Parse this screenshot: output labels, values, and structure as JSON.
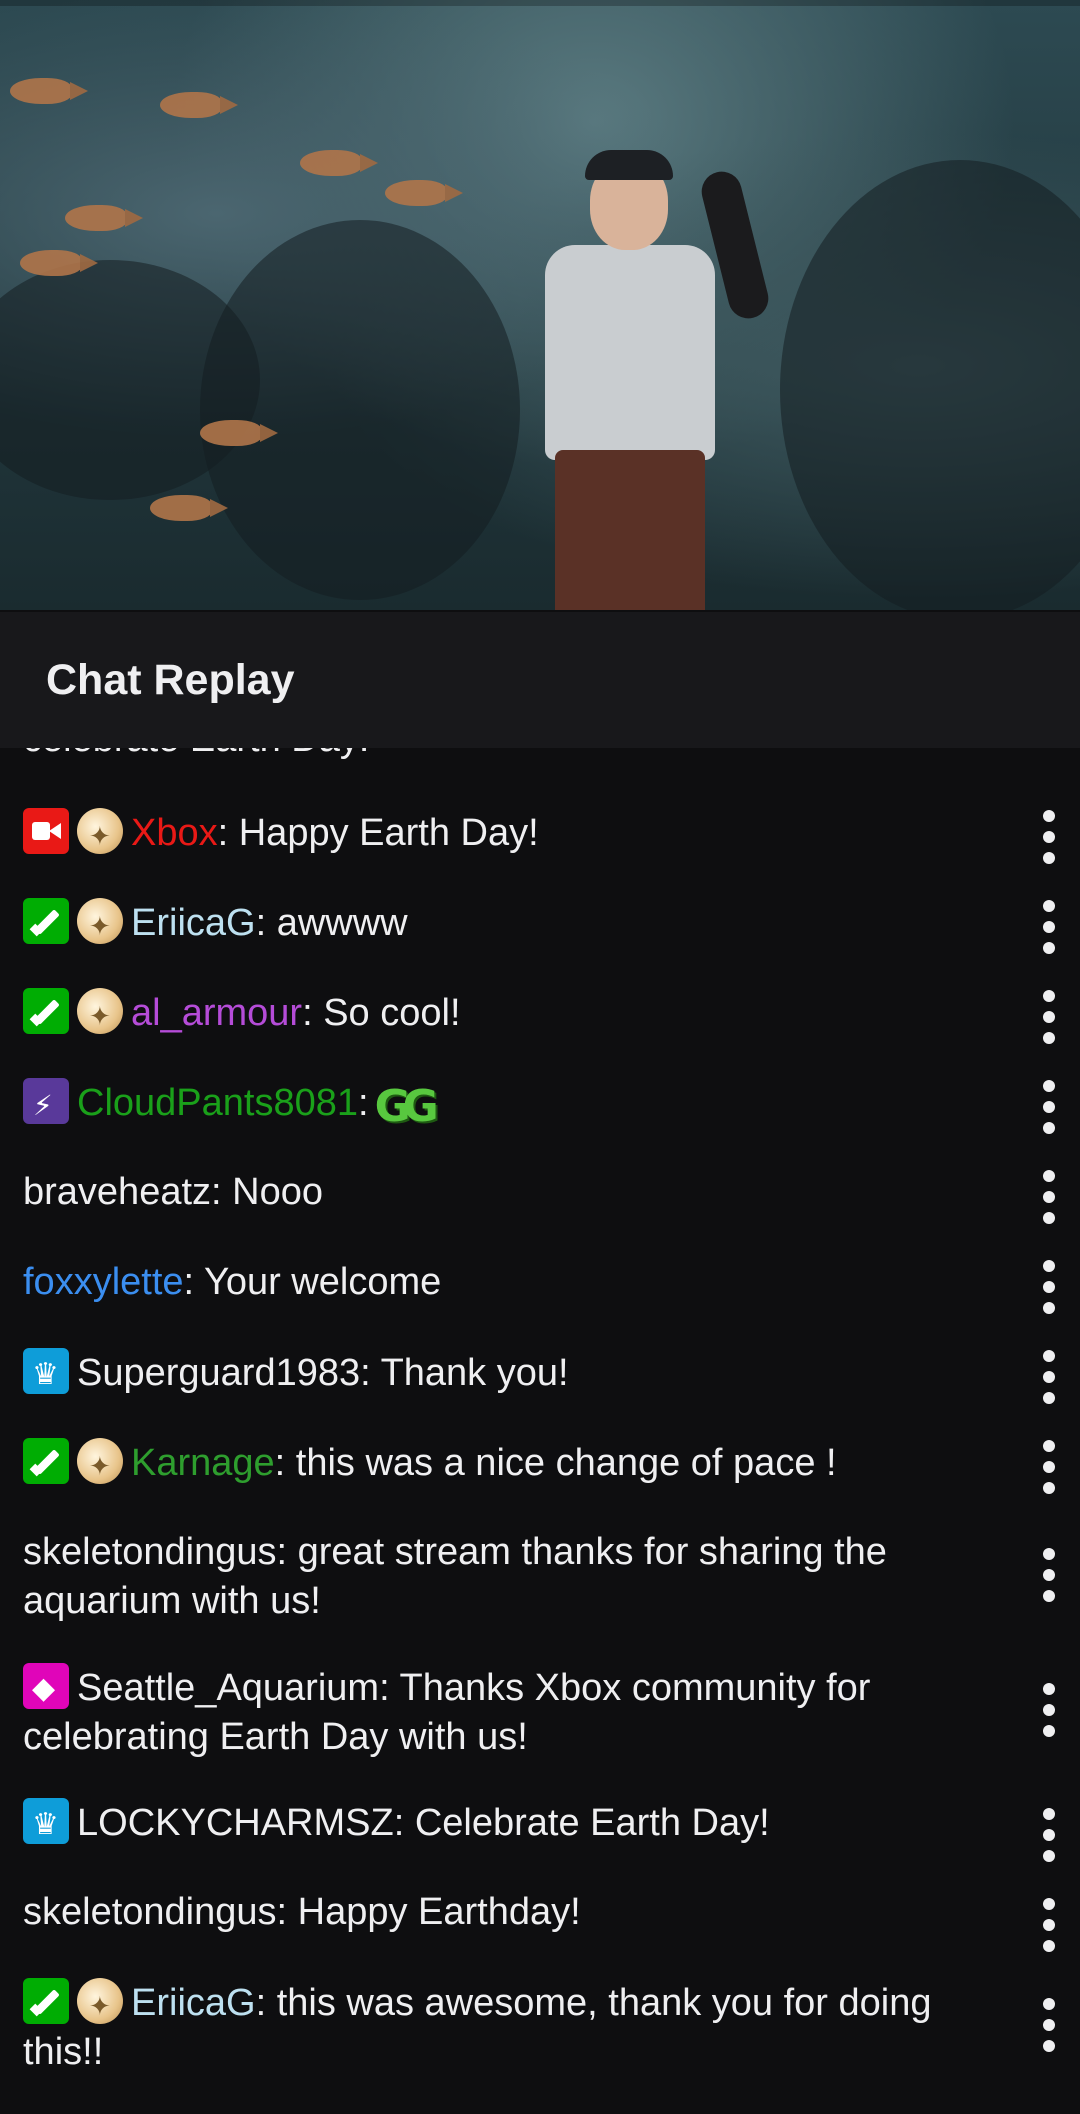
{
  "chat": {
    "title": "Chat Replay",
    "cut_off_text": "celebrate Earth Day!",
    "messages": [
      {
        "user": "Xbox",
        "user_color": "#e91916",
        "badges": [
          "broadcaster",
          "coin"
        ],
        "text": ": Happy Earth Day!"
      },
      {
        "user": "EriicaG",
        "user_color": "#bde0f0",
        "badges": [
          "mod",
          "coin"
        ],
        "text": ": awwww"
      },
      {
        "user": "al_armour",
        "user_color": "#b54cd8",
        "badges": [
          "mod",
          "coin"
        ],
        "text": ": So cool!"
      },
      {
        "user": "CloudPants8081",
        "user_color": "#1aa01a",
        "badges": [
          "turbo"
        ],
        "text": ":",
        "emote": "GG"
      },
      {
        "user": "braveheatz",
        "user_color": "#efeff1",
        "badges": [],
        "text": ": Nooo"
      },
      {
        "user": "foxxylette",
        "user_color": "#3b8ef0",
        "badges": [],
        "text": ": Your welcome"
      },
      {
        "user": "Superguard1983",
        "user_color": "#efeff1",
        "badges": [
          "prime"
        ],
        "text": ": Thank you!"
      },
      {
        "user": "Karnage",
        "user_color": "#2e9e2e",
        "badges": [
          "mod",
          "coin"
        ],
        "text": ": this was a nice change of pace !"
      },
      {
        "user": "skeletondingus",
        "user_color": "#efeff1",
        "badges": [],
        "text": ": great stream thanks for sharing the aquarium with us!"
      },
      {
        "user": "Seattle_Aquarium",
        "user_color": "#efeff1",
        "badges": [
          "partner"
        ],
        "text": ": Thanks Xbox community for celebrating Earth Day with us!"
      },
      {
        "user": "LOCKYCHARMSZ",
        "user_color": "#efeff1",
        "badges": [
          "prime"
        ],
        "text": ": Celebrate Earth Day!"
      },
      {
        "user": "skeletondingus",
        "user_color": "#efeff1",
        "badges": [],
        "text": ": Happy Earthday!"
      },
      {
        "user": "EriicaG",
        "user_color": "#bde0f0",
        "badges": [
          "mod",
          "coin"
        ],
        "text": ": this was awesome, thank you for doing this!!"
      }
    ]
  }
}
